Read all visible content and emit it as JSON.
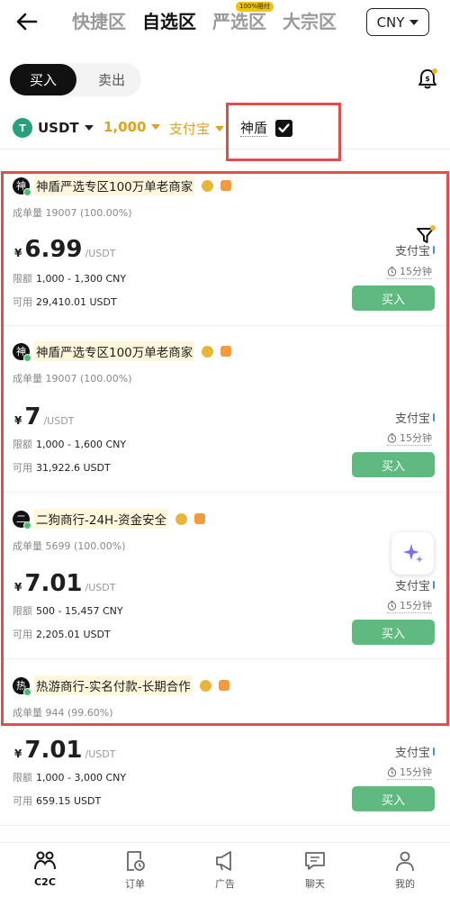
{
  "topnav": {
    "tabs": [
      {
        "label": "快捷区",
        "active": false
      },
      {
        "label": "自选区",
        "active": true
      },
      {
        "label": "严选区",
        "active": false,
        "badge": "100%赔付"
      },
      {
        "label": "大宗区",
        "active": false
      }
    ],
    "currency": "CNY"
  },
  "trade_toggle": {
    "buy": "买入",
    "sell": "卖出"
  },
  "filters": {
    "coin": "USDT",
    "coin_icon": "T",
    "amount": "1,000",
    "payment": "支付宝",
    "shield_label": "神盾",
    "shield_checked": true
  },
  "ads": [
    {
      "avatar": "神",
      "merchant": "神盾严选专区100万单老商家",
      "trades_label": "成单量",
      "trades": "19007 (100.00%)",
      "currency_symbol": "¥",
      "price": "6.99",
      "unit": "/USDT",
      "limit_label": "限额",
      "limit": "1,000 - 1,300 CNY",
      "avail_label": "可用",
      "available": "29,410.01 USDT",
      "payment": "支付宝",
      "time": "15分钟",
      "button": "买入"
    },
    {
      "avatar": "神",
      "merchant": "神盾严选专区100万单老商家",
      "trades_label": "成单量",
      "trades": "19007 (100.00%)",
      "currency_symbol": "¥",
      "price": "7",
      "unit": "/USDT",
      "limit_label": "限额",
      "limit": "1,000 - 1,600 CNY",
      "avail_label": "可用",
      "available": "31,922.6 USDT",
      "payment": "支付宝",
      "time": "15分钟",
      "button": "买入"
    },
    {
      "avatar": "二",
      "merchant": "二狗商行-24H-资金安全",
      "trades_label": "成单量",
      "trades": "5699 (100.00%)",
      "currency_symbol": "¥",
      "price": "7.01",
      "unit": "/USDT",
      "limit_label": "限额",
      "limit": "500 - 15,457 CNY",
      "avail_label": "可用",
      "available": "2,205.01 USDT",
      "payment": "支付宝",
      "time": "15分钟",
      "button": "买入"
    },
    {
      "avatar": "热",
      "merchant": "热游商行-实名付款-长期合作",
      "trades_label": "成单量",
      "trades": "944 (99.60%)",
      "currency_symbol": "¥",
      "price": "7.01",
      "unit": "/USDT",
      "limit_label": "限额",
      "limit": "1,000 - 3,000 CNY",
      "avail_label": "可用",
      "available": "659.15 USDT",
      "payment": "支付宝",
      "time": "15分钟",
      "button": "买入"
    }
  ],
  "bottomnav": [
    {
      "label": "C2C",
      "icon": "c2c-icon",
      "active": true
    },
    {
      "label": "订单",
      "icon": "order-icon",
      "active": false
    },
    {
      "label": "广告",
      "icon": "megaphone-icon",
      "active": false
    },
    {
      "label": "聊天",
      "icon": "chat-icon",
      "active": false
    },
    {
      "label": "我的",
      "icon": "profile-icon",
      "active": false
    }
  ],
  "colors": {
    "buy_green": "#5fba80",
    "accent_gold": "#e0a21a",
    "highlight_red": "#e14c4c"
  }
}
